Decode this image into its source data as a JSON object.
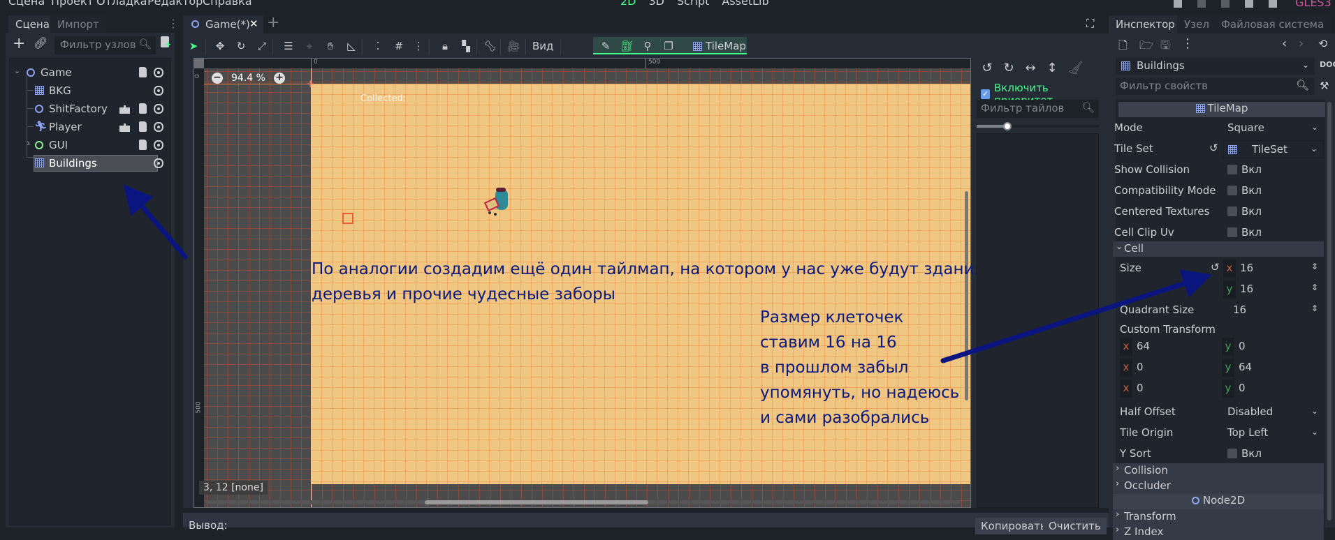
{
  "menubar": {
    "items": [
      "Сцена",
      "Проект",
      "Отладка",
      "Редактор",
      "Справка"
    ],
    "modes": [
      "2D",
      "3D",
      "Script",
      "AssetLib"
    ],
    "active_mode": "2D",
    "renderer": "GLES3"
  },
  "left_dock": {
    "tabs": [
      "Сцена",
      "Импорт"
    ],
    "active_tab": "Сцена",
    "filter_placeholder": "Фильтр узлов",
    "tree": [
      {
        "name": "Game",
        "type": "Node2D",
        "expanded": true,
        "script": true
      },
      {
        "name": "BKG",
        "type": "TileMap"
      },
      {
        "name": "ShitFactory",
        "type": "Node2D",
        "instanced": true,
        "script": true
      },
      {
        "name": "Player",
        "type": "KinematicBody2D",
        "instanced": true,
        "script": true
      },
      {
        "name": "GUI",
        "type": "Control",
        "collapsed": true,
        "script": true
      },
      {
        "name": "Buildings",
        "type": "TileMap",
        "selected": true
      }
    ]
  },
  "editor": {
    "tab_label": "Game(*)",
    "toolbar": {
      "view_menu": "Вид",
      "tilemap_label": "TileMap"
    },
    "zoom": "94.4 %",
    "ruler_top_labels": [
      "0",
      "500"
    ],
    "ruler_left_labels": [
      "0",
      "500"
    ],
    "scene_label": "Collected:",
    "cursor_coords": "3, 12 [none]"
  },
  "annotations": {
    "main": [
      "По аналогии создадим ещё один тайлмап, на котором у нас уже будут здания",
      "деревья и прочие чудесные заборы"
    ],
    "cell_size": [
      "Размер клеточек",
      "ставим 16 на 16",
      "в прошлом забыл",
      "упомянуть, но надеюсь",
      "и сами разобрались"
    ]
  },
  "tile_panel": {
    "priority_label": "Включить приоритет",
    "priority_checked": true,
    "filter_placeholder": "Фильтр тайлов",
    "zoom_slider": 0.25
  },
  "output": {
    "label": "Вывод:",
    "copy_button": "Копировать",
    "clear_button": "Очистить"
  },
  "inspector": {
    "tabs": [
      "Инспектор",
      "Узел",
      "Файловая система"
    ],
    "active_tab": "Инспектор",
    "node_name": "Buildings",
    "filter_placeholder": "Фильтр свойств",
    "class_header": "TileMap",
    "props": {
      "mode": {
        "label": "Mode",
        "value": "Square"
      },
      "tile_set": {
        "label": "Tile Set",
        "value": "TileSet"
      },
      "show_collision": {
        "label": "Show Collision",
        "value": "Вкл"
      },
      "compat_mode": {
        "label": "Compatibility Mode",
        "value": "Вкл"
      },
      "centered_textures": {
        "label": "Centered Textures",
        "value": "Вкл"
      },
      "cell_clip_uv": {
        "label": "Cell Clip Uv",
        "value": "Вкл"
      },
      "cell_section": "Cell",
      "size": {
        "label": "Size",
        "x": "16",
        "y": "16"
      },
      "quadrant_size": {
        "label": "Quadrant Size",
        "value": "16"
      },
      "custom_transform": {
        "label": "Custom Transform",
        "rows": [
          [
            "64",
            "0"
          ],
          [
            "0",
            "64"
          ],
          [
            "0",
            "0"
          ]
        ]
      },
      "half_offset": {
        "label": "Half Offset",
        "value": "Disabled"
      },
      "tile_origin": {
        "label": "Tile Origin",
        "value": "Top Left"
      },
      "y_sort": {
        "label": "Y Sort",
        "value": "Вкл"
      },
      "collision_section": "Collision",
      "occluder_section": "Occluder",
      "node2d_header": "Node2D",
      "transform_section": "Transform",
      "zindex_section": "Z Index"
    },
    "axis_x": "x",
    "axis_y": "y"
  },
  "colors": {
    "accent": "#45ff8b",
    "annotation": "#0b1a7e",
    "arrow": "#0a1580"
  }
}
